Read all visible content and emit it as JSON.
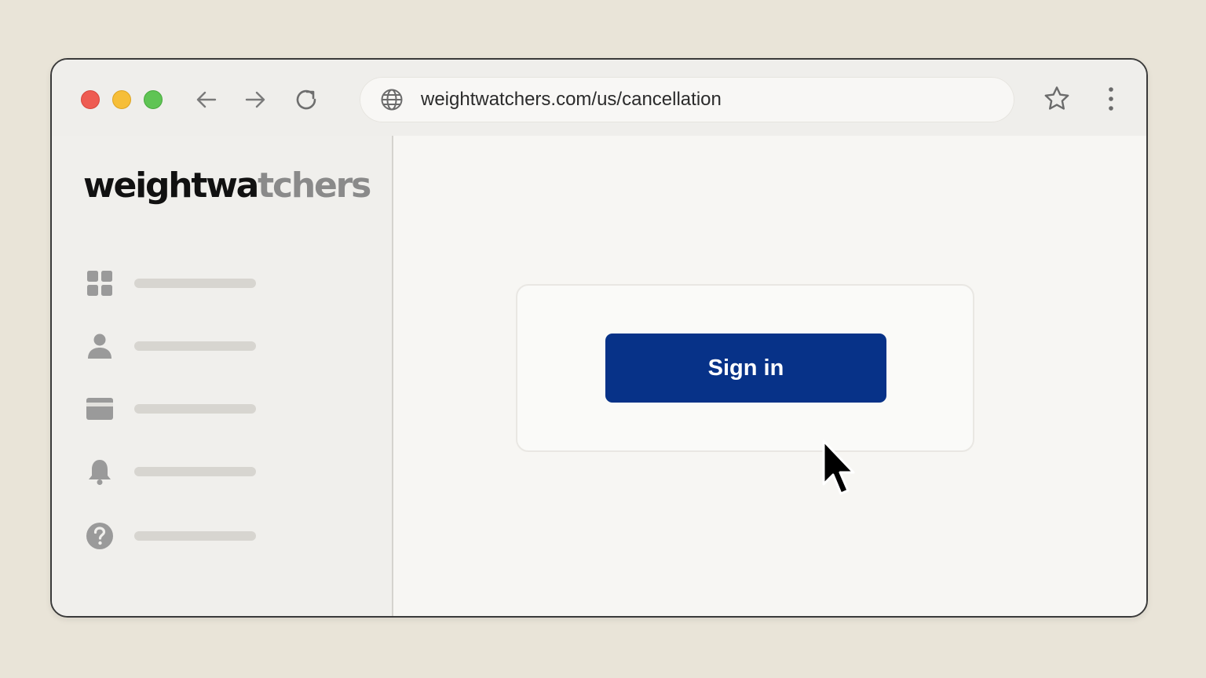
{
  "browser": {
    "url": "weightwatchers.com/us/cancellation",
    "icons": {
      "back": "arrow-left-icon",
      "forward": "arrow-right-icon",
      "reload": "reload-icon",
      "site": "globe-icon",
      "bookmark": "star-icon",
      "menu": "kebab-menu-icon"
    },
    "traffic_lights": [
      "#ee5c52",
      "#f6be38",
      "#5fc454"
    ]
  },
  "sidebar": {
    "logo": {
      "part_dark": "weightwa",
      "part_light": "tchers"
    },
    "items": [
      {
        "icon": "dashboard-grid-icon"
      },
      {
        "icon": "user-icon"
      },
      {
        "icon": "credit-card-icon"
      },
      {
        "icon": "bell-icon"
      },
      {
        "icon": "help-icon"
      }
    ]
  },
  "main": {
    "signin_label": "Sign in",
    "signin_color": "#073288"
  }
}
